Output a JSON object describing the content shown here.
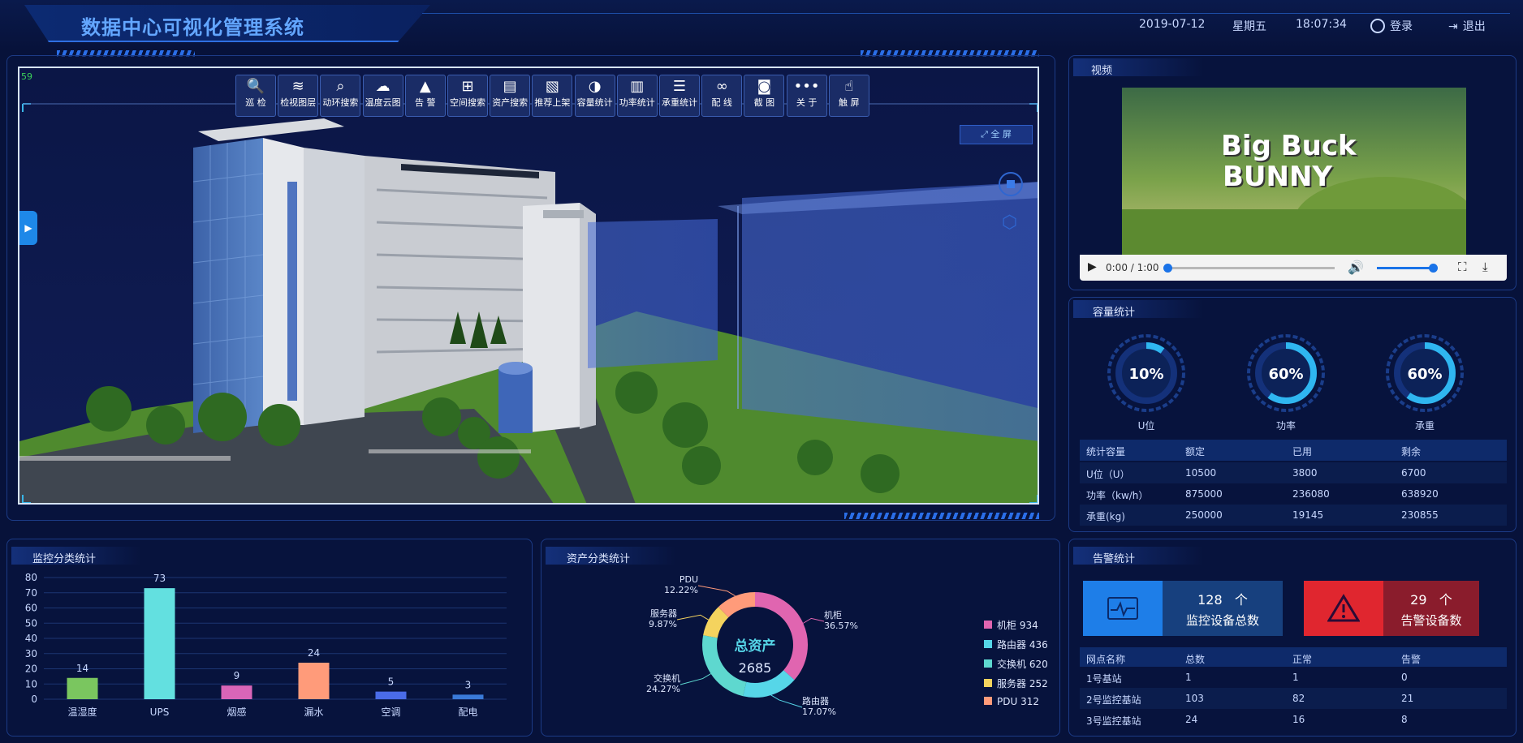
{
  "header": {
    "title": "数据中心可视化管理系统",
    "date": "2019-07-12",
    "weekday": "星期五",
    "time": "18:07:34",
    "login_label": "登录",
    "logout_label": "退出"
  },
  "scene": {
    "fps": "59",
    "fullscreen_label": "全 屏",
    "toolbar": [
      {
        "label": "巡 检",
        "icon": "inspect-icon",
        "glyph": "🔍"
      },
      {
        "label": "检视图层",
        "icon": "layers-icon",
        "glyph": "≋"
      },
      {
        "label": "动环搜索",
        "icon": "search-icon",
        "glyph": "⌕"
      },
      {
        "label": "温度云图",
        "icon": "cloud-icon",
        "glyph": "☁"
      },
      {
        "label": "告 警",
        "icon": "warning-icon",
        "glyph": "▲"
      },
      {
        "label": "空间搜索",
        "icon": "grid-icon",
        "glyph": "⊞"
      },
      {
        "label": "资产搜索",
        "icon": "clipboard-icon",
        "glyph": "▤"
      },
      {
        "label": "推荐上架",
        "icon": "document-icon",
        "glyph": "▧"
      },
      {
        "label": "容量统计",
        "icon": "pie-icon",
        "glyph": "◑"
      },
      {
        "label": "功率统计",
        "icon": "book-icon",
        "glyph": "▥"
      },
      {
        "label": "承重统计",
        "icon": "list-icon",
        "glyph": "☰"
      },
      {
        "label": "配 线",
        "icon": "link-icon",
        "glyph": "∞"
      },
      {
        "label": "截 图",
        "icon": "camera-icon",
        "glyph": "◙"
      },
      {
        "label": "关 于",
        "icon": "more-icon",
        "glyph": "•••"
      },
      {
        "label": "触 屏",
        "icon": "hand-icon",
        "glyph": "☝"
      }
    ]
  },
  "video": {
    "title": "视频",
    "poster_line1": "Big Buck",
    "poster_line2": "BUNNY",
    "time": "0:00 / 1:00",
    "progress": 0.0
  },
  "capacity": {
    "title": "容量统计",
    "gauges": [
      {
        "label": "U位",
        "value": "10%",
        "fraction": 0.1
      },
      {
        "label": "功率",
        "value": "60%",
        "fraction": 0.6
      },
      {
        "label": "承重",
        "value": "60%",
        "fraction": 0.6
      }
    ],
    "table": {
      "headers": [
        "统计容量",
        "额定",
        "已用",
        "剩余"
      ],
      "rows": [
        [
          "U位（U）",
          "10500",
          "3800",
          "6700"
        ],
        [
          "功率（kw/h）",
          "875000",
          "236080",
          "638920"
        ],
        [
          "承重(kg)",
          "250000",
          "19145",
          "230855"
        ]
      ]
    }
  },
  "monitor": {
    "title": "监控分类统计",
    "chart_data": {
      "type": "bar",
      "categories": [
        "温湿度",
        "UPS",
        "烟感",
        "漏水",
        "空调",
        "配电"
      ],
      "values": [
        14,
        73,
        9,
        24,
        5,
        3
      ],
      "colors": [
        "#7ac65f",
        "#63e0e0",
        "#d965b8",
        "#ff9b7a",
        "#4a6ce8",
        "#3a7ad8"
      ],
      "ylim": [
        0,
        80
      ],
      "yticks": [
        "0",
        "10",
        "20",
        "30",
        "40",
        "50",
        "60",
        "70",
        "80"
      ]
    }
  },
  "assets": {
    "title": "资产分类统计",
    "center_label": "总资产",
    "center_value": "2685",
    "chart_data": {
      "type": "pie",
      "slices": [
        {
          "name": "机柜",
          "value": 934,
          "percent": "36.57%",
          "color": "#e065b0"
        },
        {
          "name": "路由器",
          "value": 436,
          "percent": "17.07%",
          "color": "#56d6e8"
        },
        {
          "name": "交换机",
          "value": 620,
          "percent": "24.27%",
          "color": "#5ed8cf"
        },
        {
          "name": "服务器",
          "value": 252,
          "percent": "9.87%",
          "color": "#f4d35e"
        },
        {
          "name": "PDU",
          "value": 312,
          "percent": "12.22%",
          "color": "#ff9b7a"
        }
      ]
    },
    "legend": [
      "机柜 934",
      "路由器 436",
      "交换机 620",
      "服务器 252",
      "PDU 312"
    ],
    "callouts": [
      {
        "name": "机柜",
        "pct": "36.57%"
      },
      {
        "name": "路由器",
        "pct": "17.07%"
      },
      {
        "name": "交换机",
        "pct": "24.27%"
      },
      {
        "name": "服务器",
        "pct": "9.87%"
      },
      {
        "name": "PDU",
        "pct": "12.22%"
      }
    ]
  },
  "alarm": {
    "title": "告警统计",
    "monitor_count": "128",
    "monitor_unit": "个",
    "monitor_label": "监控设备总数",
    "alarm_count": "29",
    "alarm_unit": "个",
    "alarm_label": "告警设备数",
    "table": {
      "headers": [
        "网点名称",
        "总数",
        "正常",
        "告警"
      ],
      "rows": [
        [
          "1号基站",
          "1",
          "1",
          "0"
        ],
        [
          "2号监控基站",
          "103",
          "82",
          "21"
        ],
        [
          "3号监控基站",
          "24",
          "16",
          "8"
        ]
      ]
    }
  },
  "colors": {
    "accent": "#2f6fe0",
    "panel_border": "#1c3b86",
    "alarm_red": "#e0262f",
    "monitor_blue": "#1e7ee8"
  }
}
